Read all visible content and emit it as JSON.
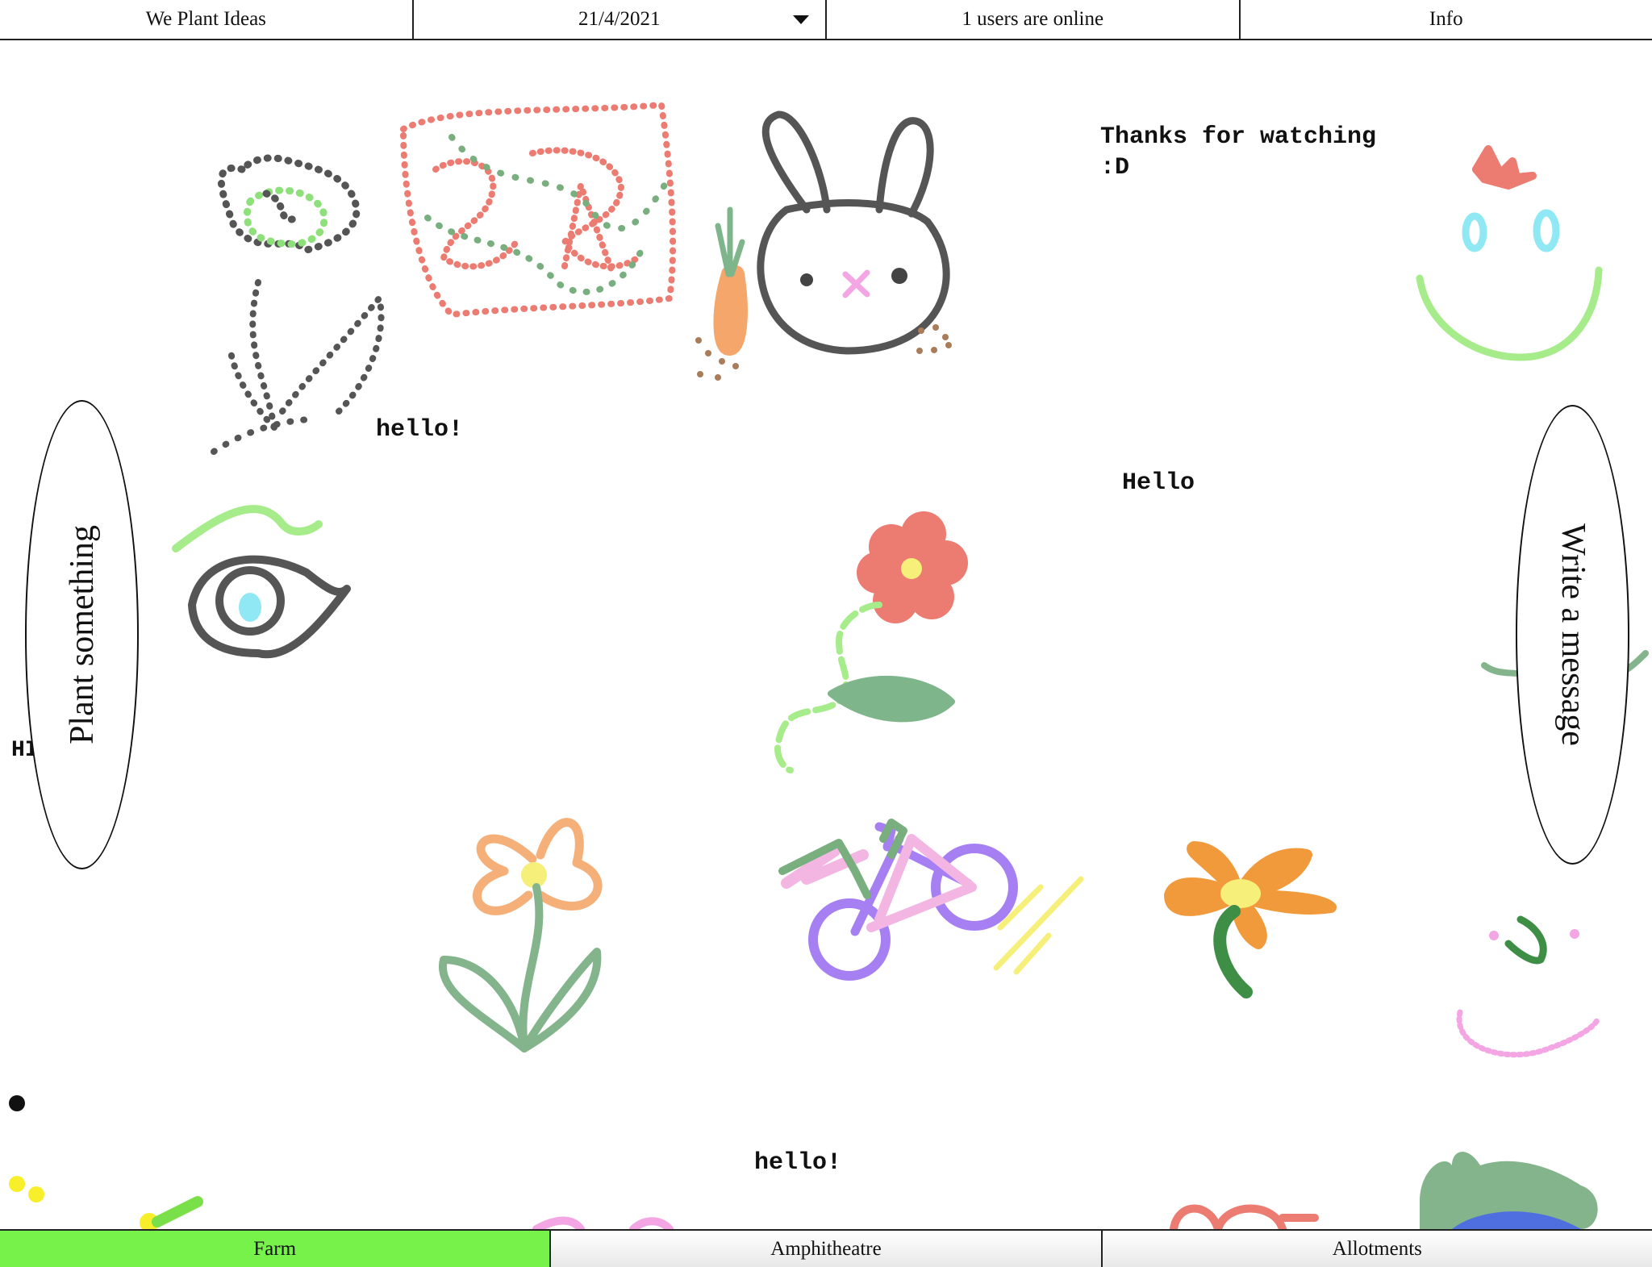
{
  "header": {
    "title": "We Plant Ideas",
    "date": "21/4/2021",
    "online": "1 users are online",
    "info": "Info"
  },
  "canvas": {
    "messages": {
      "thanks": "Thanks for watching\n:D",
      "hello_top": "hello!",
      "hello_mid": "Hello",
      "hello_bottom": "hello!",
      "partial_left": "HI"
    }
  },
  "actions": {
    "plant": "Plant something",
    "write": "Write a message"
  },
  "tabs": [
    {
      "label": "Farm",
      "active": true
    },
    {
      "label": "Amphitheatre",
      "active": false
    },
    {
      "label": "Allotments",
      "active": false
    }
  ],
  "colors": {
    "active_tab": "#76f24a",
    "border": "#222222"
  }
}
